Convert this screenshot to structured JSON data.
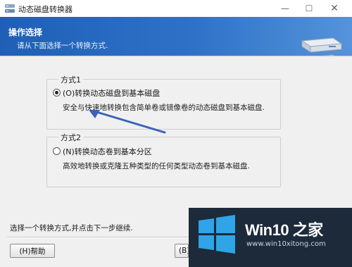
{
  "window": {
    "title": "动态磁盘转换器",
    "minimize_glyph": "—",
    "maximize_glyph": "☐",
    "close_glyph": "✕"
  },
  "header": {
    "title": "操作选择",
    "subtitle": "请从下面选择一个转换方式."
  },
  "options": [
    {
      "group_title": "方式1",
      "label": "(O)转换动态磁盘到基本磁盘",
      "description": "安全与快速地转换包含简单卷或镜像卷的动态磁盘到基本磁盘.",
      "selected": true
    },
    {
      "group_title": "方式2",
      "label": "(N)转换动态卷到基本分区",
      "description": "高效地转换或克隆五种类型的任何类型动态卷到基本磁盘.",
      "selected": false
    }
  ],
  "footer": {
    "instruction": "选择一个转换方式,并点击下一步继续.",
    "help_label": "(H)帮助",
    "back_label": "(B)"
  },
  "watermark": {
    "brand": "Win10 之家",
    "url": "www.win10xitong.com"
  },
  "colors": {
    "banner": "#2e72c8",
    "arrow": "#3a62b8",
    "logo_blue": "#2fa4e7"
  },
  "icons": [
    "app-icon",
    "disk-drives-icon",
    "radio-button",
    "arrow-annotation",
    "windows-logo"
  ]
}
